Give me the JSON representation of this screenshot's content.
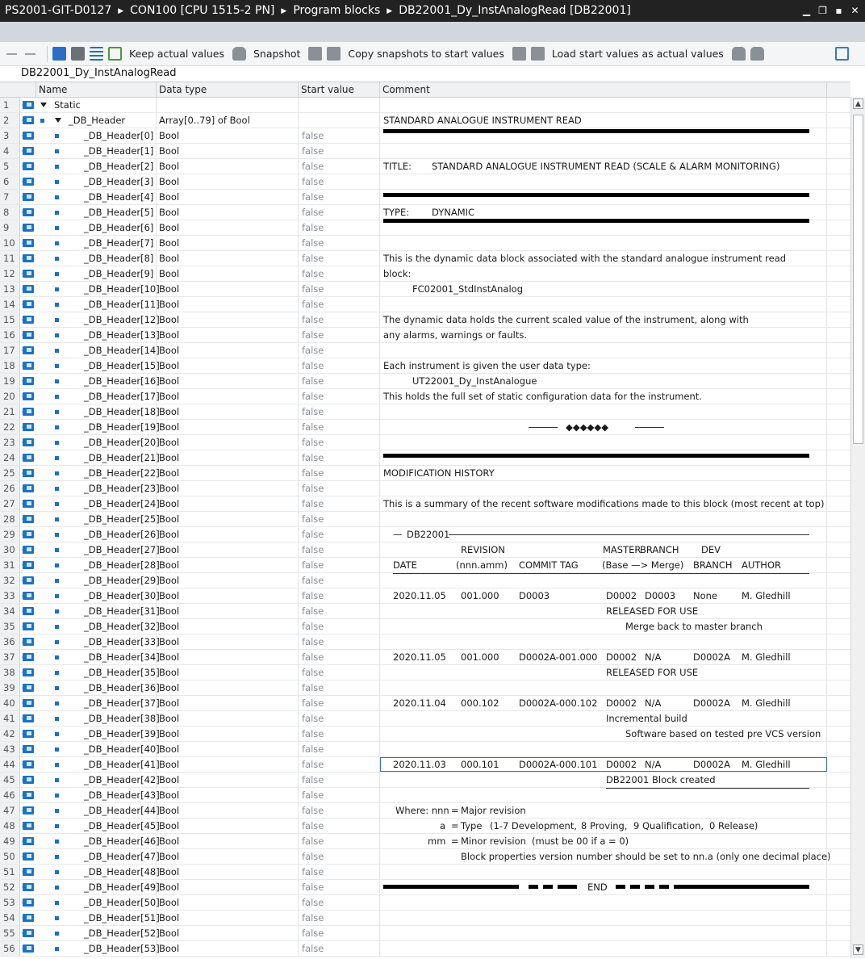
{
  "window": {
    "breadcrumb": [
      "PS2001-GIT-D0127",
      "CON100 [CPU 1515-2 PN]",
      "Program blocks",
      "DB22001_Dy_InstAnalogRead [DB22001]"
    ],
    "controls": [
      "minimize-icon",
      "restore-icon",
      "float-icon",
      "close-icon"
    ]
  },
  "toolbar": {
    "keep_actual": "Keep actual values",
    "snapshot": "Snapshot",
    "copy_snapshots": "Copy snapshots to start values",
    "load_start": "Load start values as actual values"
  },
  "block_name": "DB22001_Dy_InstAnalogRead",
  "columns": {
    "name": "Name",
    "data_type": "Data type",
    "start_value": "Start value",
    "comment": "Comment"
  },
  "rows": [
    {
      "n": "1",
      "name": "Static",
      "type": "",
      "start": ""
    },
    {
      "n": "2",
      "name": "_DB_Header",
      "type": "Array[0..79] of Bool",
      "start": ""
    },
    {
      "n": "3",
      "name": "_DB_Header[0]",
      "type": "Bool",
      "start": "false"
    },
    {
      "n": "4",
      "name": "_DB_Header[1]",
      "type": "Bool",
      "start": "false"
    },
    {
      "n": "5",
      "name": "_DB_Header[2]",
      "type": "Bool",
      "start": "false"
    },
    {
      "n": "6",
      "name": "_DB_Header[3]",
      "type": "Bool",
      "start": "false"
    },
    {
      "n": "7",
      "name": "_DB_Header[4]",
      "type": "Bool",
      "start": "false"
    },
    {
      "n": "8",
      "name": "_DB_Header[5]",
      "type": "Bool",
      "start": "false"
    },
    {
      "n": "9",
      "name": "_DB_Header[6]",
      "type": "Bool",
      "start": "false"
    },
    {
      "n": "10",
      "name": "_DB_Header[7]",
      "type": "Bool",
      "start": "false"
    },
    {
      "n": "11",
      "name": "_DB_Header[8]",
      "type": "Bool",
      "start": "false"
    },
    {
      "n": "12",
      "name": "_DB_Header[9]",
      "type": "Bool",
      "start": "false"
    },
    {
      "n": "13",
      "name": "_DB_Header[10]",
      "type": "Bool",
      "start": "false"
    },
    {
      "n": "14",
      "name": "_DB_Header[11]",
      "type": "Bool",
      "start": "false"
    },
    {
      "n": "15",
      "name": "_DB_Header[12]",
      "type": "Bool",
      "start": "false"
    },
    {
      "n": "16",
      "name": "_DB_Header[13]",
      "type": "Bool",
      "start": "false"
    },
    {
      "n": "17",
      "name": "_DB_Header[14]",
      "type": "Bool",
      "start": "false"
    },
    {
      "n": "18",
      "name": "_DB_Header[15]",
      "type": "Bool",
      "start": "false"
    },
    {
      "n": "19",
      "name": "_DB_Header[16]",
      "type": "Bool",
      "start": "false"
    },
    {
      "n": "20",
      "name": "_DB_Header[17]",
      "type": "Bool",
      "start": "false"
    },
    {
      "n": "21",
      "name": "_DB_Header[18]",
      "type": "Bool",
      "start": "false"
    },
    {
      "n": "22",
      "name": "_DB_Header[19]",
      "type": "Bool",
      "start": "false"
    },
    {
      "n": "23",
      "name": "_DB_Header[20]",
      "type": "Bool",
      "start": "false"
    },
    {
      "n": "24",
      "name": "_DB_Header[21]",
      "type": "Bool",
      "start": "false"
    },
    {
      "n": "25",
      "name": "_DB_Header[22]",
      "type": "Bool",
      "start": "false"
    },
    {
      "n": "26",
      "name": "_DB_Header[23]",
      "type": "Bool",
      "start": "false"
    },
    {
      "n": "27",
      "name": "_DB_Header[24]",
      "type": "Bool",
      "start": "false"
    },
    {
      "n": "28",
      "name": "_DB_Header[25]",
      "type": "Bool",
      "start": "false"
    },
    {
      "n": "29",
      "name": "_DB_Header[26]",
      "type": "Bool",
      "start": "false"
    },
    {
      "n": "30",
      "name": "_DB_Header[27]",
      "type": "Bool",
      "start": "false"
    },
    {
      "n": "31",
      "name": "_DB_Header[28]",
      "type": "Bool",
      "start": "false"
    },
    {
      "n": "32",
      "name": "_DB_Header[29]",
      "type": "Bool",
      "start": "false"
    },
    {
      "n": "33",
      "name": "_DB_Header[30]",
      "type": "Bool",
      "start": "false"
    },
    {
      "n": "34",
      "name": "_DB_Header[31]",
      "type": "Bool",
      "start": "false"
    },
    {
      "n": "35",
      "name": "_DB_Header[32]",
      "type": "Bool",
      "start": "false"
    },
    {
      "n": "36",
      "name": "_DB_Header[33]",
      "type": "Bool",
      "start": "false"
    },
    {
      "n": "37",
      "name": "_DB_Header[34]",
      "type": "Bool",
      "start": "false"
    },
    {
      "n": "38",
      "name": "_DB_Header[35]",
      "type": "Bool",
      "start": "false"
    },
    {
      "n": "39",
      "name": "_DB_Header[36]",
      "type": "Bool",
      "start": "false"
    },
    {
      "n": "40",
      "name": "_DB_Header[37]",
      "type": "Bool",
      "start": "false"
    },
    {
      "n": "41",
      "name": "_DB_Header[38]",
      "type": "Bool",
      "start": "false"
    },
    {
      "n": "42",
      "name": "_DB_Header[39]",
      "type": "Bool",
      "start": "false"
    },
    {
      "n": "43",
      "name": "_DB_Header[40]",
      "type": "Bool",
      "start": "false"
    },
    {
      "n": "44",
      "name": "_DB_Header[41]",
      "type": "Bool",
      "start": "false"
    },
    {
      "n": "45",
      "name": "_DB_Header[42]",
      "type": "Bool",
      "start": "false"
    },
    {
      "n": "46",
      "name": "_DB_Header[43]",
      "type": "Bool",
      "start": "false"
    },
    {
      "n": "47",
      "name": "_DB_Header[44]",
      "type": "Bool",
      "start": "false"
    },
    {
      "n": "48",
      "name": "_DB_Header[45]",
      "type": "Bool",
      "start": "false"
    },
    {
      "n": "49",
      "name": "_DB_Header[46]",
      "type": "Bool",
      "start": "false"
    },
    {
      "n": "50",
      "name": "_DB_Header[47]",
      "type": "Bool",
      "start": "false"
    },
    {
      "n": "51",
      "name": "_DB_Header[48]",
      "type": "Bool",
      "start": "false"
    },
    {
      "n": "52",
      "name": "_DB_Header[49]",
      "type": "Bool",
      "start": "false"
    },
    {
      "n": "53",
      "name": "_DB_Header[50]",
      "type": "Bool",
      "start": "false"
    },
    {
      "n": "54",
      "name": "_DB_Header[51]",
      "type": "Bool",
      "start": "false"
    },
    {
      "n": "55",
      "name": "_DB_Header[52]",
      "type": "Bool",
      "start": "false"
    },
    {
      "n": "56",
      "name": "_DB_Header[53]",
      "type": "Bool",
      "start": "false"
    }
  ],
  "comments": {
    "2": [
      {
        "t": "STANDARD ANALOGUE INSTRUMENT READ"
      }
    ],
    "5": [
      {
        "t": "TITLE:"
      },
      {
        "t": "STANDARD ANALOGUE INSTRUMENT READ (SCALE & ALARM MONITORING)"
      }
    ],
    "8": [
      {
        "t": "TYPE:"
      },
      {
        "t": "DYNAMIC"
      }
    ],
    "11": [
      {
        "t": "This is the dynamic data block associated with the standard analogue instrument read"
      }
    ],
    "12": [
      {
        "t": "block:"
      }
    ],
    "13": [
      {
        "t": "FC02001_StdInstAnalog"
      }
    ],
    "15": [
      {
        "t": "The dynamic data holds the current scaled value of the instrument, along with"
      }
    ],
    "16": [
      {
        "t": "any alarms, warnings or faults."
      }
    ],
    "18": [
      {
        "t": "Each instrument is given the user data type:"
      }
    ],
    "19": [
      {
        "t": "UT22001_Dy_InstAnalogue"
      }
    ],
    "20": [
      {
        "t": "This holds the full set of static configuration data for the instrument."
      }
    ],
    "22": [
      {
        "t": "◆◆◆◆◆◆"
      }
    ],
    "25": [
      {
        "t": "MODIFICATION HISTORY"
      }
    ],
    "27": [
      {
        "t": "This is a summary of the recent software modifications made to this block (most recent at top)"
      }
    ],
    "29": [
      {
        "t": "—"
      },
      {
        "t": "DB22001"
      }
    ],
    "30": [
      {
        "t": "REVISION"
      },
      {
        "t": "MASTER"
      },
      {
        "t": "BRANCH"
      },
      {
        "t": "DEV"
      }
    ],
    "31": [
      {
        "t": "DATE"
      },
      {
        "t": "(nnn.amm)"
      },
      {
        "t": "COMMIT TAG"
      },
      {
        "t": "(Base —> Merge)"
      },
      {
        "t": "BRANCH"
      },
      {
        "t": "AUTHOR"
      }
    ],
    "33": [
      {
        "t": "2020.11.05"
      },
      {
        "t": "001.000"
      },
      {
        "t": "D0003"
      },
      {
        "t": "D0002"
      },
      {
        "t": "D0003"
      },
      {
        "t": "None"
      },
      {
        "t": "M. Gledhill"
      }
    ],
    "34": [
      {
        "t": "RELEASED FOR USE"
      }
    ],
    "35": [
      {
        "t": "Merge back to master branch"
      }
    ],
    "37": [
      {
        "t": "2020.11.05"
      },
      {
        "t": "001.000"
      },
      {
        "t": "D0002A-001.000"
      },
      {
        "t": "D0002"
      },
      {
        "t": "N/A"
      },
      {
        "t": "D0002A"
      },
      {
        "t": "M. Gledhill"
      }
    ],
    "38": [
      {
        "t": "RELEASED FOR USE"
      }
    ],
    "40": [
      {
        "t": "2020.11.04"
      },
      {
        "t": "000.102"
      },
      {
        "t": "D0002A-000.102"
      },
      {
        "t": "D0002"
      },
      {
        "t": "N/A"
      },
      {
        "t": "D0002A"
      },
      {
        "t": "M. Gledhill"
      }
    ],
    "41": [
      {
        "t": "Incremental build"
      }
    ],
    "42": [
      {
        "t": "Software based on tested pre VCS version"
      }
    ],
    "44": [
      {
        "t": "2020.11.03"
      },
      {
        "t": "000.101"
      },
      {
        "t": "D0002A-000.101"
      },
      {
        "t": "D0002"
      },
      {
        "t": "N/A"
      },
      {
        "t": "D0002A"
      },
      {
        "t": "M. Gledhill"
      }
    ],
    "45": [
      {
        "t": "DB22001 Block created"
      }
    ],
    "47": [
      {
        "t": "Where: nnn"
      },
      {
        "t": "="
      },
      {
        "t": "Major revision"
      }
    ],
    "48": [
      {
        "t": "a"
      },
      {
        "t": "="
      },
      {
        "t": "Type"
      },
      {
        "t": "(1-7 Development,"
      },
      {
        "t": "8 Proving,"
      },
      {
        "t": "9 Qualification,"
      },
      {
        "t": "0 Release)"
      }
    ],
    "49": [
      {
        "t": "mm"
      },
      {
        "t": "="
      },
      {
        "t": "Minor revision"
      },
      {
        "t": "(must be 00 if a = 0)"
      }
    ],
    "50": [
      {
        "t": "Block properties version number should be set to nn.a (only one decimal place)"
      }
    ],
    "52": [
      {
        "t": "END"
      }
    ]
  },
  "colors": {
    "title_bg": "#222222",
    "strip_bg": "#d2d7dd",
    "icon_blue": "#1a72c8",
    "selection": "#3a6fb8"
  }
}
